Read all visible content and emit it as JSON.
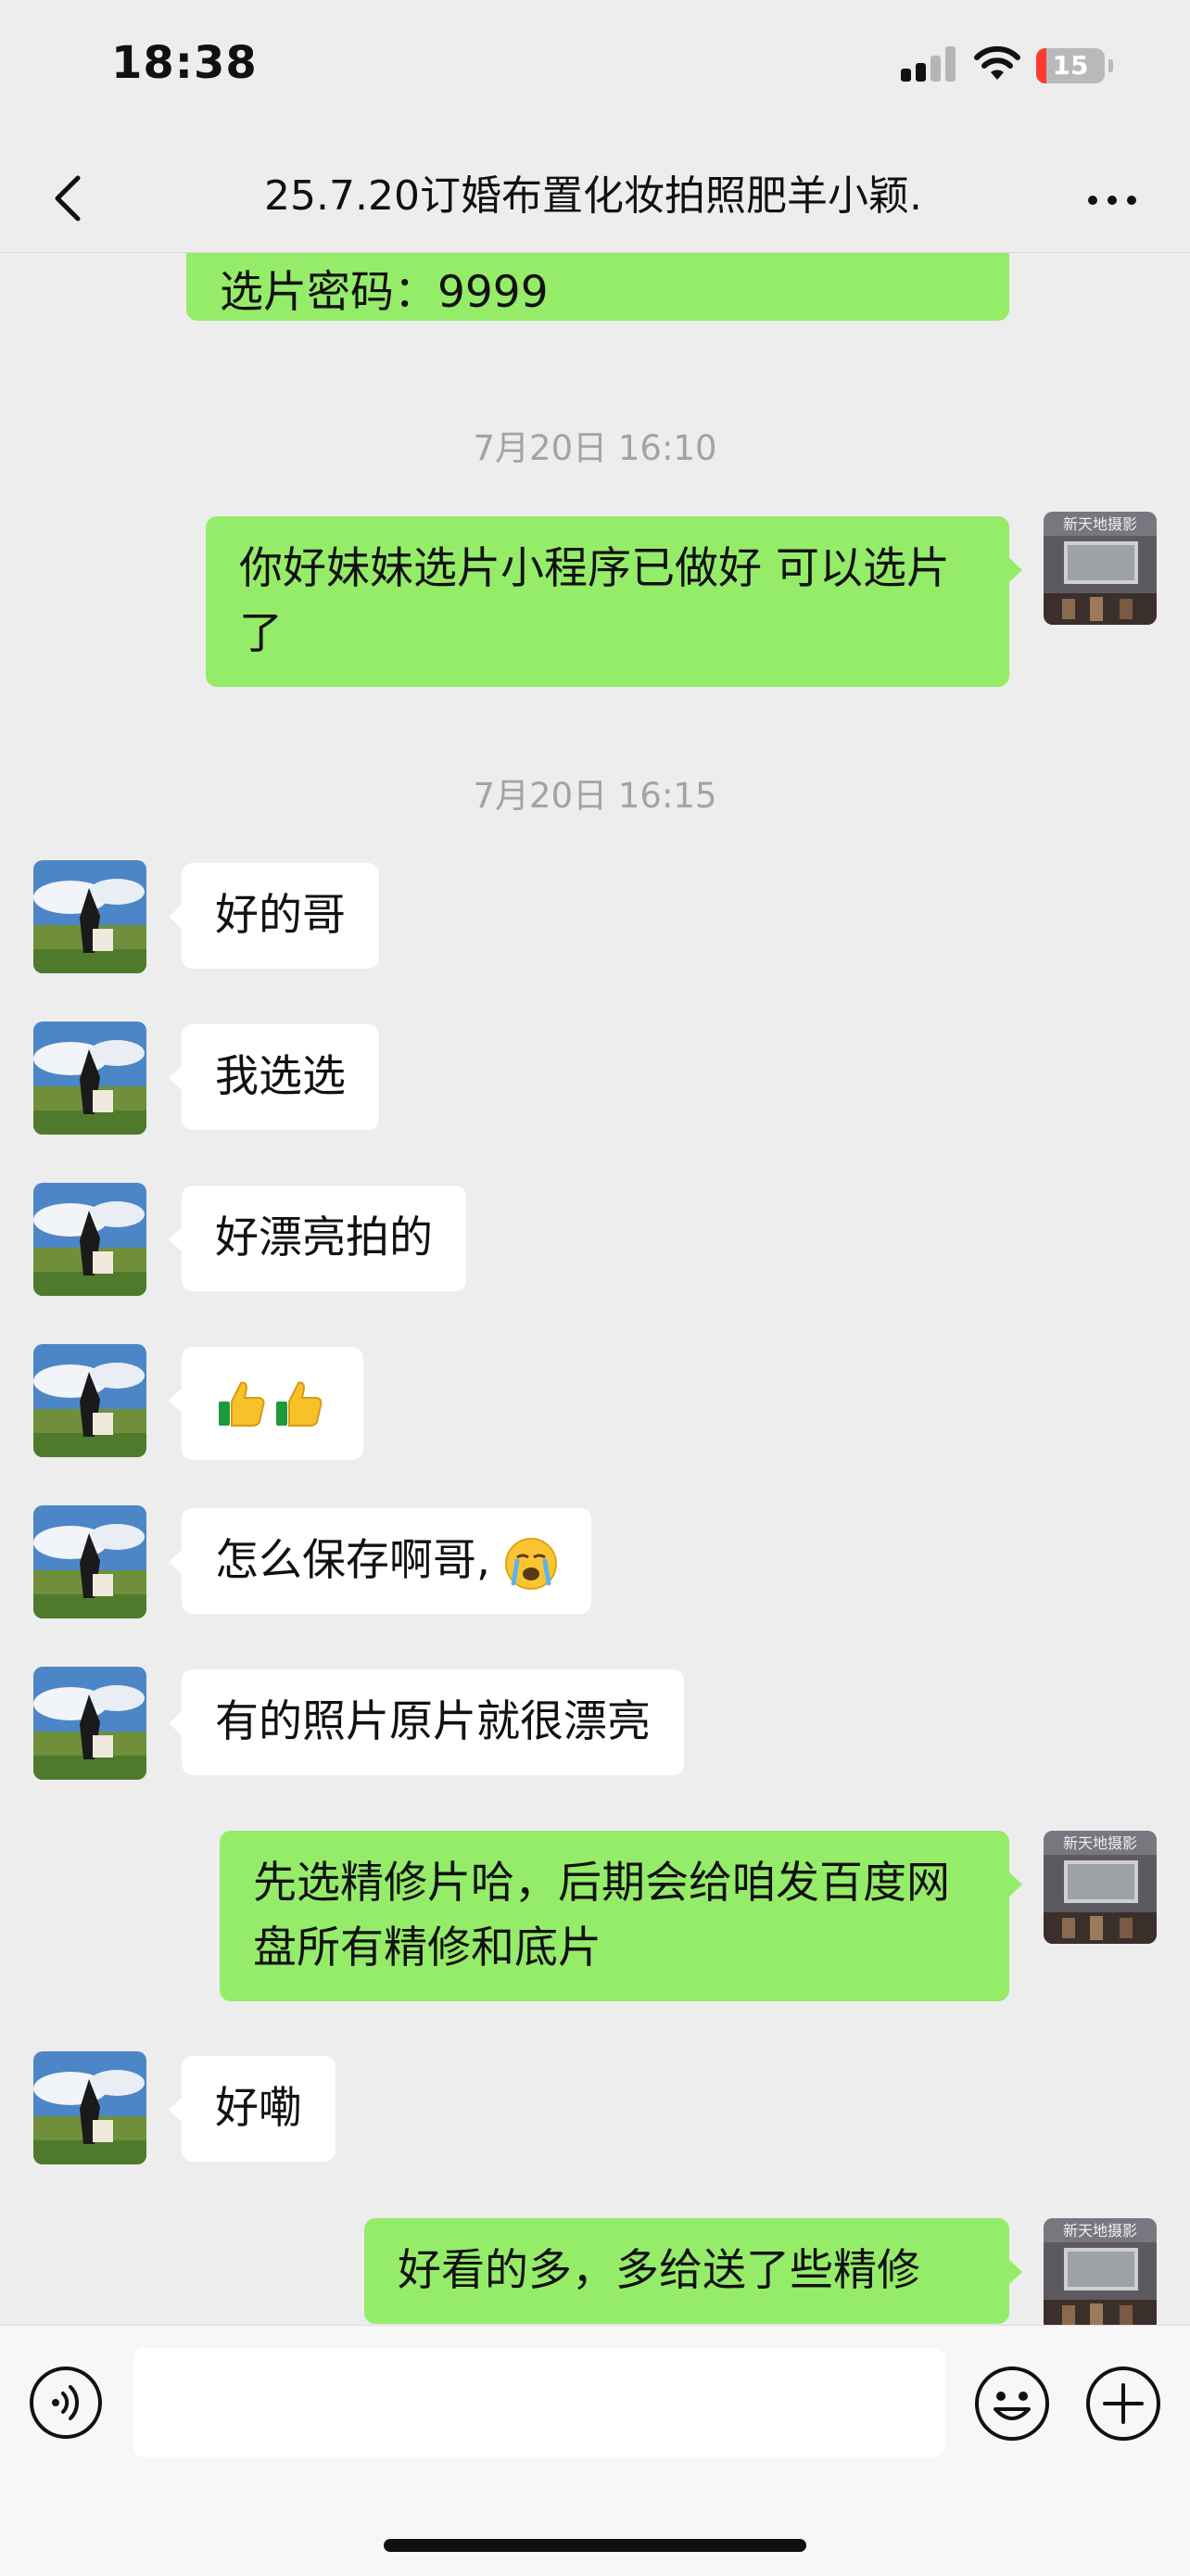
{
  "status_bar": {
    "time": "18:38",
    "battery": "15",
    "battery_level": 0.15,
    "icons": [
      "signal-icon",
      "wifi-icon",
      "battery-icon"
    ]
  },
  "header": {
    "title": "25.7.20订婚布置化妆拍照肥羊小颖.",
    "back_icon": "chevron-left-icon",
    "more_icon": "more-dots-icon"
  },
  "messages": [
    {
      "type": "out",
      "text": "选片密码：9999"
    },
    {
      "type": "time",
      "text": "7月20日 16:10"
    },
    {
      "type": "out",
      "text": "你好妹妹选片小程序已做好 可以选片了",
      "avatar_text": "新天地摄影"
    },
    {
      "type": "time",
      "text": "7月20日 16:15"
    },
    {
      "type": "in",
      "text": "好的哥"
    },
    {
      "type": "in",
      "text": "我选选"
    },
    {
      "type": "in",
      "text": "好漂亮拍的"
    },
    {
      "type": "in",
      "text": "",
      "emoji": "thumbs-up-icon x2"
    },
    {
      "type": "in",
      "text": "怎么保存啊哥,",
      "emoji": "crying-face-icon"
    },
    {
      "type": "in",
      "text": "有的照片原片就很漂亮"
    },
    {
      "type": "out",
      "text": "先选精修片哈，后期会给咱发百度网盘所有精修和底片",
      "avatar_text": "新天地摄影"
    },
    {
      "type": "in",
      "text": "好嘞"
    },
    {
      "type": "out",
      "text": "好看的多，多给送了些精修",
      "avatar_text": "新天地摄影"
    }
  ],
  "input_bar": {
    "voice_icon": "voice-icon",
    "emoji_icon": "smile-icon",
    "plus_icon": "plus-circle-icon",
    "value": ""
  },
  "colors": {
    "background": "#ededed",
    "outgoing_bubble": "#95ec69",
    "incoming_bubble": "#ffffff",
    "time_label": "#a3a3a3"
  }
}
